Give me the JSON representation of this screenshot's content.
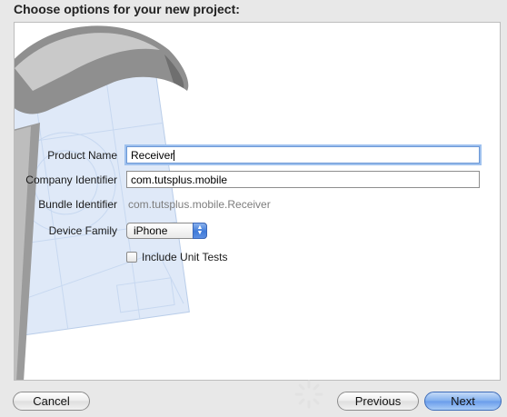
{
  "header": {
    "title": "Choose options for your new project:"
  },
  "form": {
    "product_name": {
      "label": "Product Name",
      "value": "Receiver"
    },
    "company_identifier": {
      "label": "Company Identifier",
      "value": "com.tutsplus.mobile"
    },
    "bundle_identifier": {
      "label": "Bundle Identifier",
      "value": "com.tutsplus.mobile.Receiver"
    },
    "device_family": {
      "label": "Device Family",
      "selected": "iPhone"
    },
    "unit_tests": {
      "label": "Include Unit Tests",
      "checked": false
    }
  },
  "buttons": {
    "cancel": "Cancel",
    "previous": "Previous",
    "next": "Next"
  },
  "colors": {
    "accent": "#6a9deb",
    "focus_ring": "#9fc1ee"
  }
}
